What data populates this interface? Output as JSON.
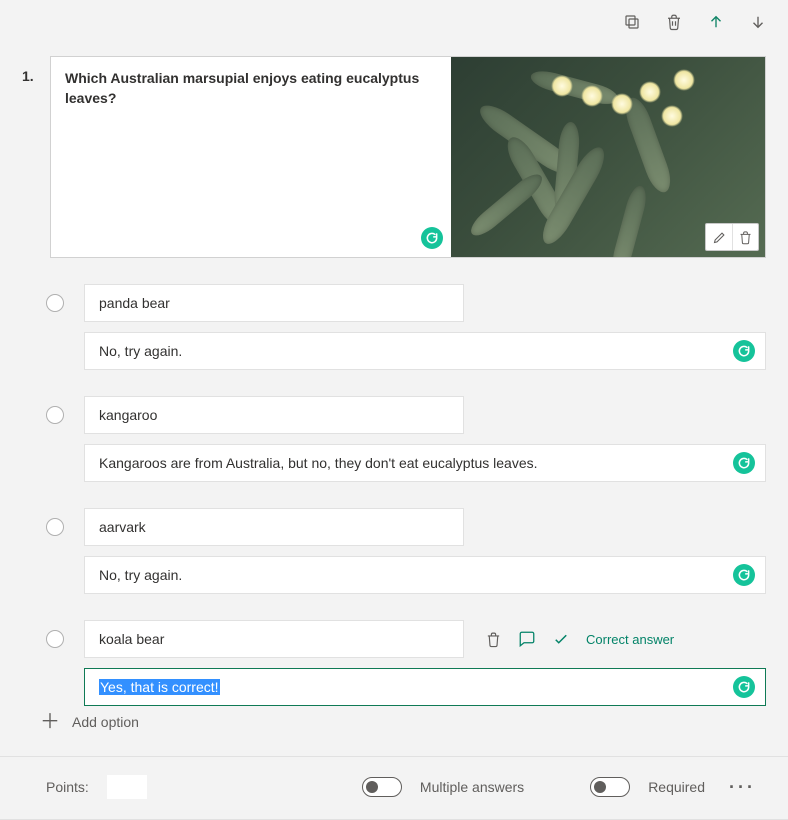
{
  "question": {
    "number": "1.",
    "text": "Which Australian marsupial enjoys eating eucalyptus leaves?",
    "imageAlt": "eucalyptus-photo"
  },
  "options": [
    {
      "answer": "panda bear",
      "feedback": "No, try again.",
      "correct": false,
      "showExtras": false,
      "feedbackActive": false
    },
    {
      "answer": "kangaroo",
      "feedback": "Kangaroos are from Australia, but no, they don't eat eucalyptus leaves.",
      "correct": false,
      "showExtras": false,
      "feedbackActive": false
    },
    {
      "answer": "aarvark",
      "feedback": "No, try again.",
      "correct": false,
      "showExtras": false,
      "feedbackActive": false
    },
    {
      "answer": "koala bear",
      "feedback": "Yes, that is correct!",
      "correct": true,
      "showExtras": true,
      "feedbackActive": true
    }
  ],
  "labels": {
    "correctAnswer": "Correct answer",
    "addOption": "Add option",
    "points": "Points:",
    "multipleAnswers": "Multiple answers",
    "required": "Required"
  },
  "footer": {
    "pointsValue": "",
    "multipleAnswersOn": false,
    "requiredOn": false
  }
}
